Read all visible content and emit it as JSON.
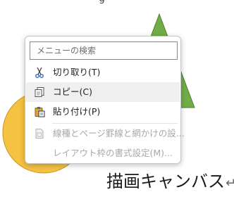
{
  "canvas": {
    "label": "描画キャンバス",
    "paragraph_mark": "↵",
    "colors": {
      "circle": "#f5c242",
      "triangle": "#70ad47"
    }
  },
  "context_menu": {
    "search_placeholder": "メニューの検索",
    "items": [
      {
        "label": "切り取り(T)",
        "icon": "scissors-icon",
        "enabled": true
      },
      {
        "label": "コピー(C)",
        "icon": "copy-icon",
        "enabled": true,
        "highlighted": true
      },
      {
        "label": "貼り付け(P)",
        "icon": "paste-icon",
        "enabled": true
      },
      {
        "label": "線種とページ罫線と網かけの設...",
        "icon": "page-border-icon",
        "enabled": false
      },
      {
        "label": "レイアウト枠の書式設定(M)...",
        "icon": "",
        "enabled": false
      }
    ]
  }
}
